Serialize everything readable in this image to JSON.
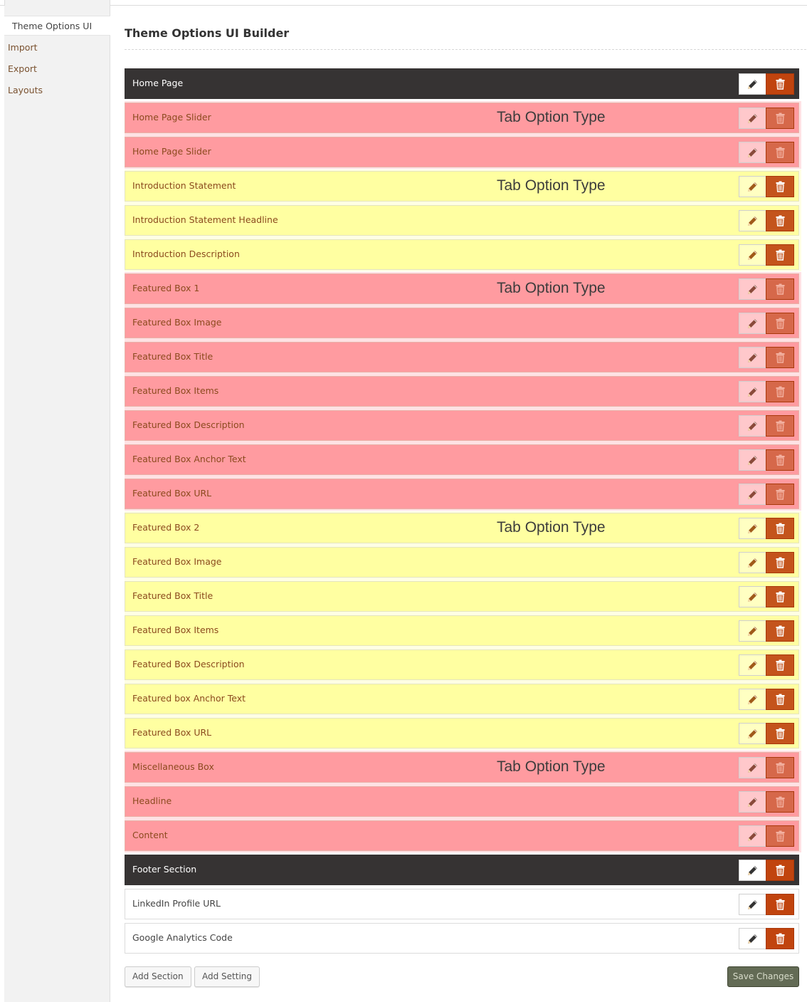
{
  "sidebar": {
    "items": [
      {
        "label": "Theme Options UI",
        "active": true
      },
      {
        "label": "Import",
        "active": false
      },
      {
        "label": "Export",
        "active": false
      },
      {
        "label": "Layouts",
        "active": false
      }
    ]
  },
  "main": {
    "title": "Theme Options UI Builder",
    "tab_type_label": "Tab Option Type",
    "rows": [
      {
        "label": "Home Page",
        "style": "dark"
      },
      {
        "label": "Home Page Slider",
        "style": "red",
        "tab_type": true
      },
      {
        "label": "Home Page Slider",
        "style": "red"
      },
      {
        "label": "Introduction Statement",
        "style": "yellow",
        "tab_type": true
      },
      {
        "label": "Introduction Statement Headline",
        "style": "yellow"
      },
      {
        "label": "Introduction Description",
        "style": "yellow"
      },
      {
        "label": "Featured Box 1",
        "style": "red",
        "tab_type": true
      },
      {
        "label": "Featured Box Image",
        "style": "red"
      },
      {
        "label": "Featured Box Title",
        "style": "red"
      },
      {
        "label": "Featured Box Items",
        "style": "red"
      },
      {
        "label": "Featured Box Description",
        "style": "red"
      },
      {
        "label": "Featured Box Anchor Text",
        "style": "red"
      },
      {
        "label": "Featured Box URL",
        "style": "red"
      },
      {
        "label": "Featured Box 2",
        "style": "yellow",
        "tab_type": true
      },
      {
        "label": "Featured Box Image",
        "style": "yellow"
      },
      {
        "label": "Featured Box Title",
        "style": "yellow"
      },
      {
        "label": "Featured Box Items",
        "style": "yellow"
      },
      {
        "label": "Featured Box Description",
        "style": "yellow"
      },
      {
        "label": "Featured box Anchor Text",
        "style": "yellow"
      },
      {
        "label": "Featured Box URL",
        "style": "yellow"
      },
      {
        "label": "Miscellaneous Box",
        "style": "red",
        "tab_type": true
      },
      {
        "label": "Headline",
        "style": "red"
      },
      {
        "label": "Content",
        "style": "red"
      },
      {
        "label": "Footer Section",
        "style": "dark"
      },
      {
        "label": "LinkedIn Profile URL",
        "style": "white"
      },
      {
        "label": "Google Analytics Code",
        "style": "white"
      }
    ]
  },
  "footer": {
    "add_section_label": "Add Section",
    "add_setting_label": "Add Setting",
    "save_label": "Save Changes"
  },
  "colors": {
    "dark_row": "#363333",
    "delete_button": "#c1440e",
    "red_highlight": "#ff7076",
    "yellow_highlight": "#ffff78",
    "save_button": "#636b55"
  },
  "icons": {
    "edit": "pencil-icon",
    "delete": "trash-icon"
  }
}
